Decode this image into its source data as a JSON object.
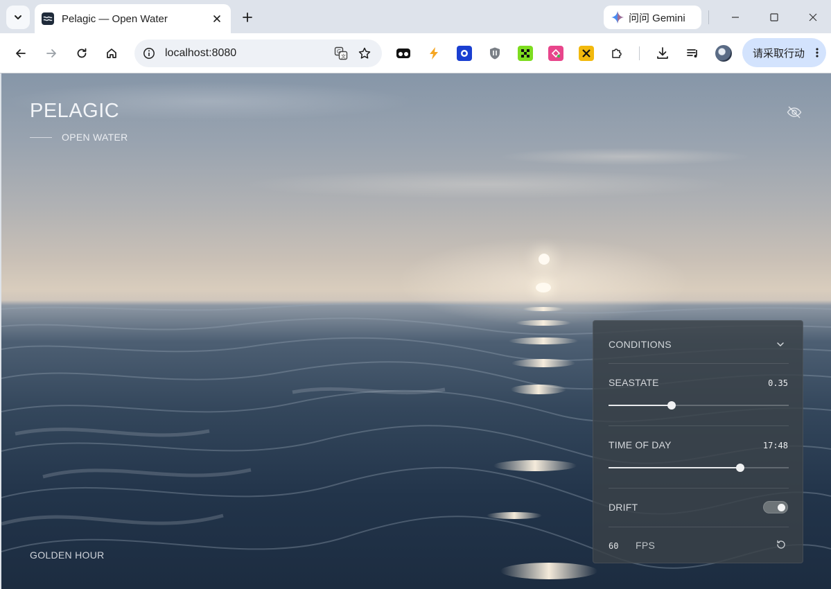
{
  "browser": {
    "tab_title": "Pelagic — Open Water",
    "url": "localhost:8080",
    "gemini_label": "问问 Gemini",
    "action_button_label": "请采取行动",
    "extensions": [
      "tampermonkey-icon",
      "bolt-icon",
      "blue-shield-icon",
      "ublock-icon",
      "green-grid-icon",
      "pink-puzzle-icon",
      "yellow-x-icon",
      "extensions-puzzle-icon"
    ]
  },
  "scene": {
    "brand": "PELAGIC",
    "subtitle": "OPEN WATER",
    "mode": "GOLDEN HOUR"
  },
  "panel": {
    "title": "CONDITIONS",
    "seastate": {
      "label": "SEASTATE",
      "value_text": "0.35",
      "value": 0.35
    },
    "time_of_day": {
      "label": "TIME OF DAY",
      "value_text": "17:48",
      "fraction": 0.73
    },
    "drift": {
      "label": "DRIFT",
      "on": true
    },
    "fps": {
      "value": "60",
      "label": "FPS"
    }
  },
  "colors": {
    "panel_bg": "#3a4248",
    "accent": "#f0f1f2",
    "action_button": "#d3e3fd"
  }
}
